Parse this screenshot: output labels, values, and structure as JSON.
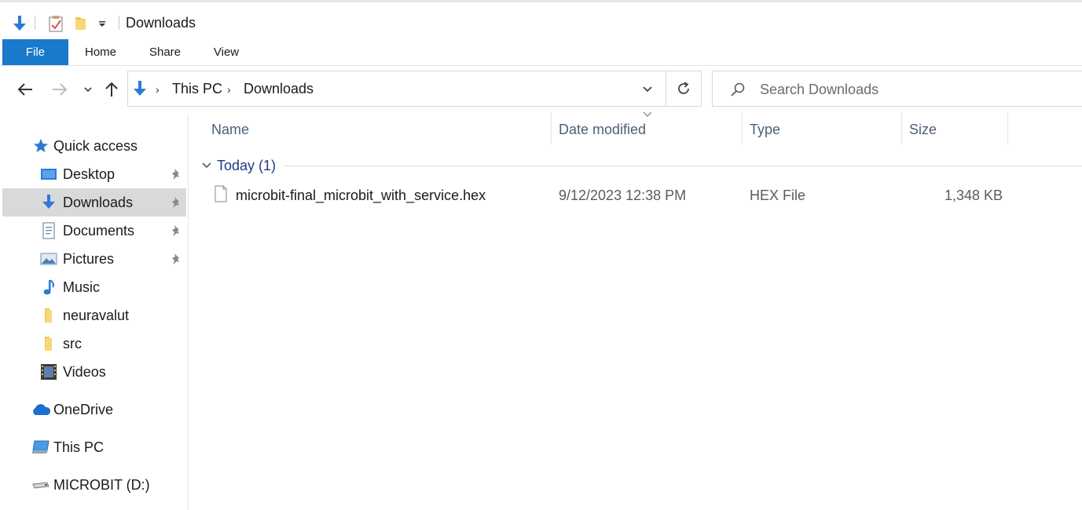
{
  "window": {
    "title": "Downloads"
  },
  "ribbon": {
    "tabs": [
      "File",
      "Home",
      "Share",
      "View"
    ]
  },
  "address": {
    "crumbs": [
      "This PC",
      "Downloads"
    ],
    "search_placeholder": "Search Downloads"
  },
  "sidebar": {
    "quick_access": "Quick access",
    "items": [
      {
        "label": "Desktop",
        "icon": "desktop-icon",
        "pinned": true
      },
      {
        "label": "Downloads",
        "icon": "download-arrow-icon",
        "pinned": true,
        "selected": true
      },
      {
        "label": "Documents",
        "icon": "documents-icon",
        "pinned": true
      },
      {
        "label": "Pictures",
        "icon": "pictures-icon",
        "pinned": true
      },
      {
        "label": "Music",
        "icon": "music-note-icon",
        "pinned": false
      },
      {
        "label": "neuravalut",
        "icon": "folder-icon",
        "pinned": false
      },
      {
        "label": "src",
        "icon": "folder-icon",
        "pinned": false
      },
      {
        "label": "Videos",
        "icon": "film-icon",
        "pinned": false
      }
    ],
    "onedrive": "OneDrive",
    "this_pc": "This PC",
    "drive": "MICROBIT (D:)"
  },
  "columns": {
    "name": "Name",
    "date": "Date modified",
    "type": "Type",
    "size": "Size"
  },
  "group": {
    "label": "Today (1)"
  },
  "files": [
    {
      "name": "microbit-final_microbit_with_service.hex",
      "date": "9/12/2023 12:38 PM",
      "type": "HEX File",
      "size": "1,348 KB"
    }
  ],
  "colors": {
    "accent": "#1979ca",
    "selection": "#d9d9d9",
    "header_text": "#4c607a",
    "group_text": "#1e3a8a"
  }
}
